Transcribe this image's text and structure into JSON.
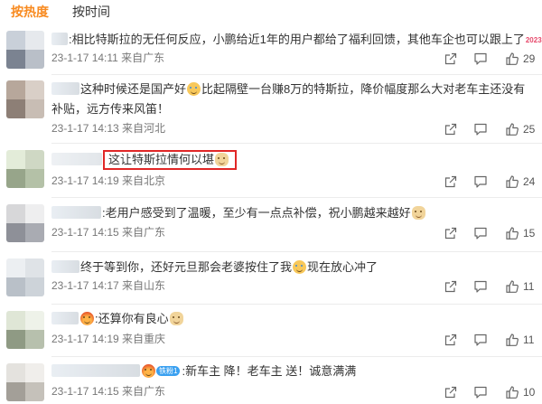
{
  "tabs": [
    {
      "label": "按热度",
      "active": true
    },
    {
      "label": "按时间",
      "active": false
    }
  ],
  "icons": {
    "share": "share-icon",
    "reply": "reply-icon",
    "like": "thumbs-up-icon"
  },
  "accent_color": "#f88a1f",
  "highlight_color": "#e02727",
  "comments": [
    {
      "pre": ":相比特斯拉的无任何反应，小鹏给近1年的用户都给了福利回馈，其他车企也可以跟上了",
      "year_badge": "2023",
      "meta": "23-1-17 14:11 来自广东",
      "likes": "29"
    },
    {
      "pre": "这种时候还是国产好",
      "post": "比起隔壁一台赚8万的特斯拉，降价幅度那么大对老车主还没有补贴，远方传来风笛！",
      "meta": "23-1-17 14:13 来自河北",
      "likes": "25"
    },
    {
      "pre": "这让特斯拉情何以堪",
      "meta": "23-1-17 14:19 来自北京",
      "likes": "24"
    },
    {
      "pre": ":老用户感受到了温暖，至少有一点点补偿，祝小鹏越来越好",
      "meta": "23-1-17 14:15 来自广东",
      "likes": "15"
    },
    {
      "pre": "终于等到你，还好元旦那会老婆按住了我",
      "post": "现在放心冲了",
      "meta": "23-1-17 14:17 来自山东",
      "likes": "11"
    },
    {
      "pre": ":还算你有良心",
      "meta": "23-1-17 14:19 来自重庆",
      "likes": "11"
    },
    {
      "badge": "铁粉1",
      "pre": ":新车主 降！老车主 送！诚意满满",
      "meta": "23-1-17 14:15 来自广东",
      "likes": "10"
    }
  ]
}
